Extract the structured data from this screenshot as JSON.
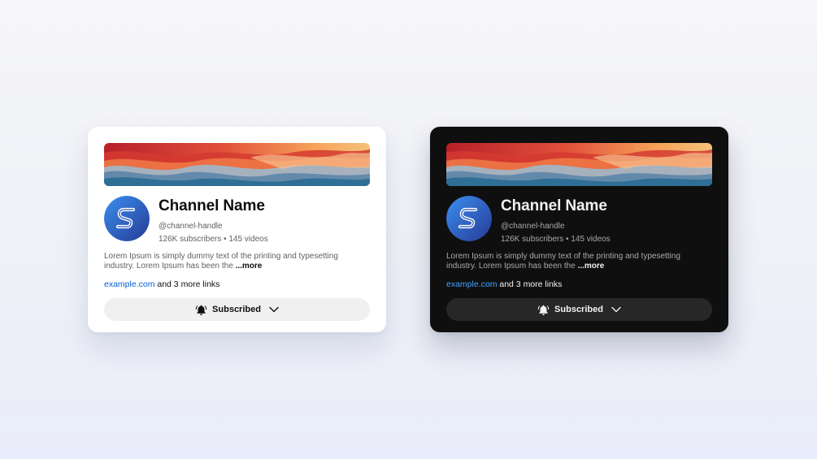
{
  "cards": [
    {
      "theme": "light",
      "channel_name": "Channel Name",
      "handle": "@channel-handle",
      "stats": "126K subscribers • 145 videos",
      "description": "Lorem Ipsum is simply dummy text of the printing and typesetting industry. Lorem Ipsum has been the ",
      "more_label": "...more",
      "link_text": "example.com",
      "more_links": " and 3 more links",
      "subscribe_label": "Subscribed",
      "icons": {
        "bell": "bell-icon",
        "chevron": "chevron-down-icon",
        "avatar": "channel-logo-s"
      },
      "colors": {
        "card_bg": "#ffffff",
        "text": "#0f0f0f",
        "secondary": "#606060",
        "link": "#065fd4",
        "button_bg": "#f0f0f0"
      }
    },
    {
      "theme": "dark",
      "channel_name": "Channel Name",
      "handle": "@channel-handle",
      "stats": "126K subscribers • 145 videos",
      "description": "Lorem Ipsum is simply dummy text of the printing and typesetting industry. Lorem Ipsum has been the ",
      "more_label": "...more",
      "link_text": "example.com",
      "more_links": " and 3 more links",
      "subscribe_label": "Subscribed",
      "icons": {
        "bell": "bell-icon",
        "chevron": "chevron-down-icon",
        "avatar": "channel-logo-s"
      },
      "colors": {
        "card_bg": "#0f0f0f",
        "text": "#f1f1f1",
        "secondary": "#aaaaaa",
        "link": "#3ea6ff",
        "button_bg": "#272727"
      }
    }
  ]
}
